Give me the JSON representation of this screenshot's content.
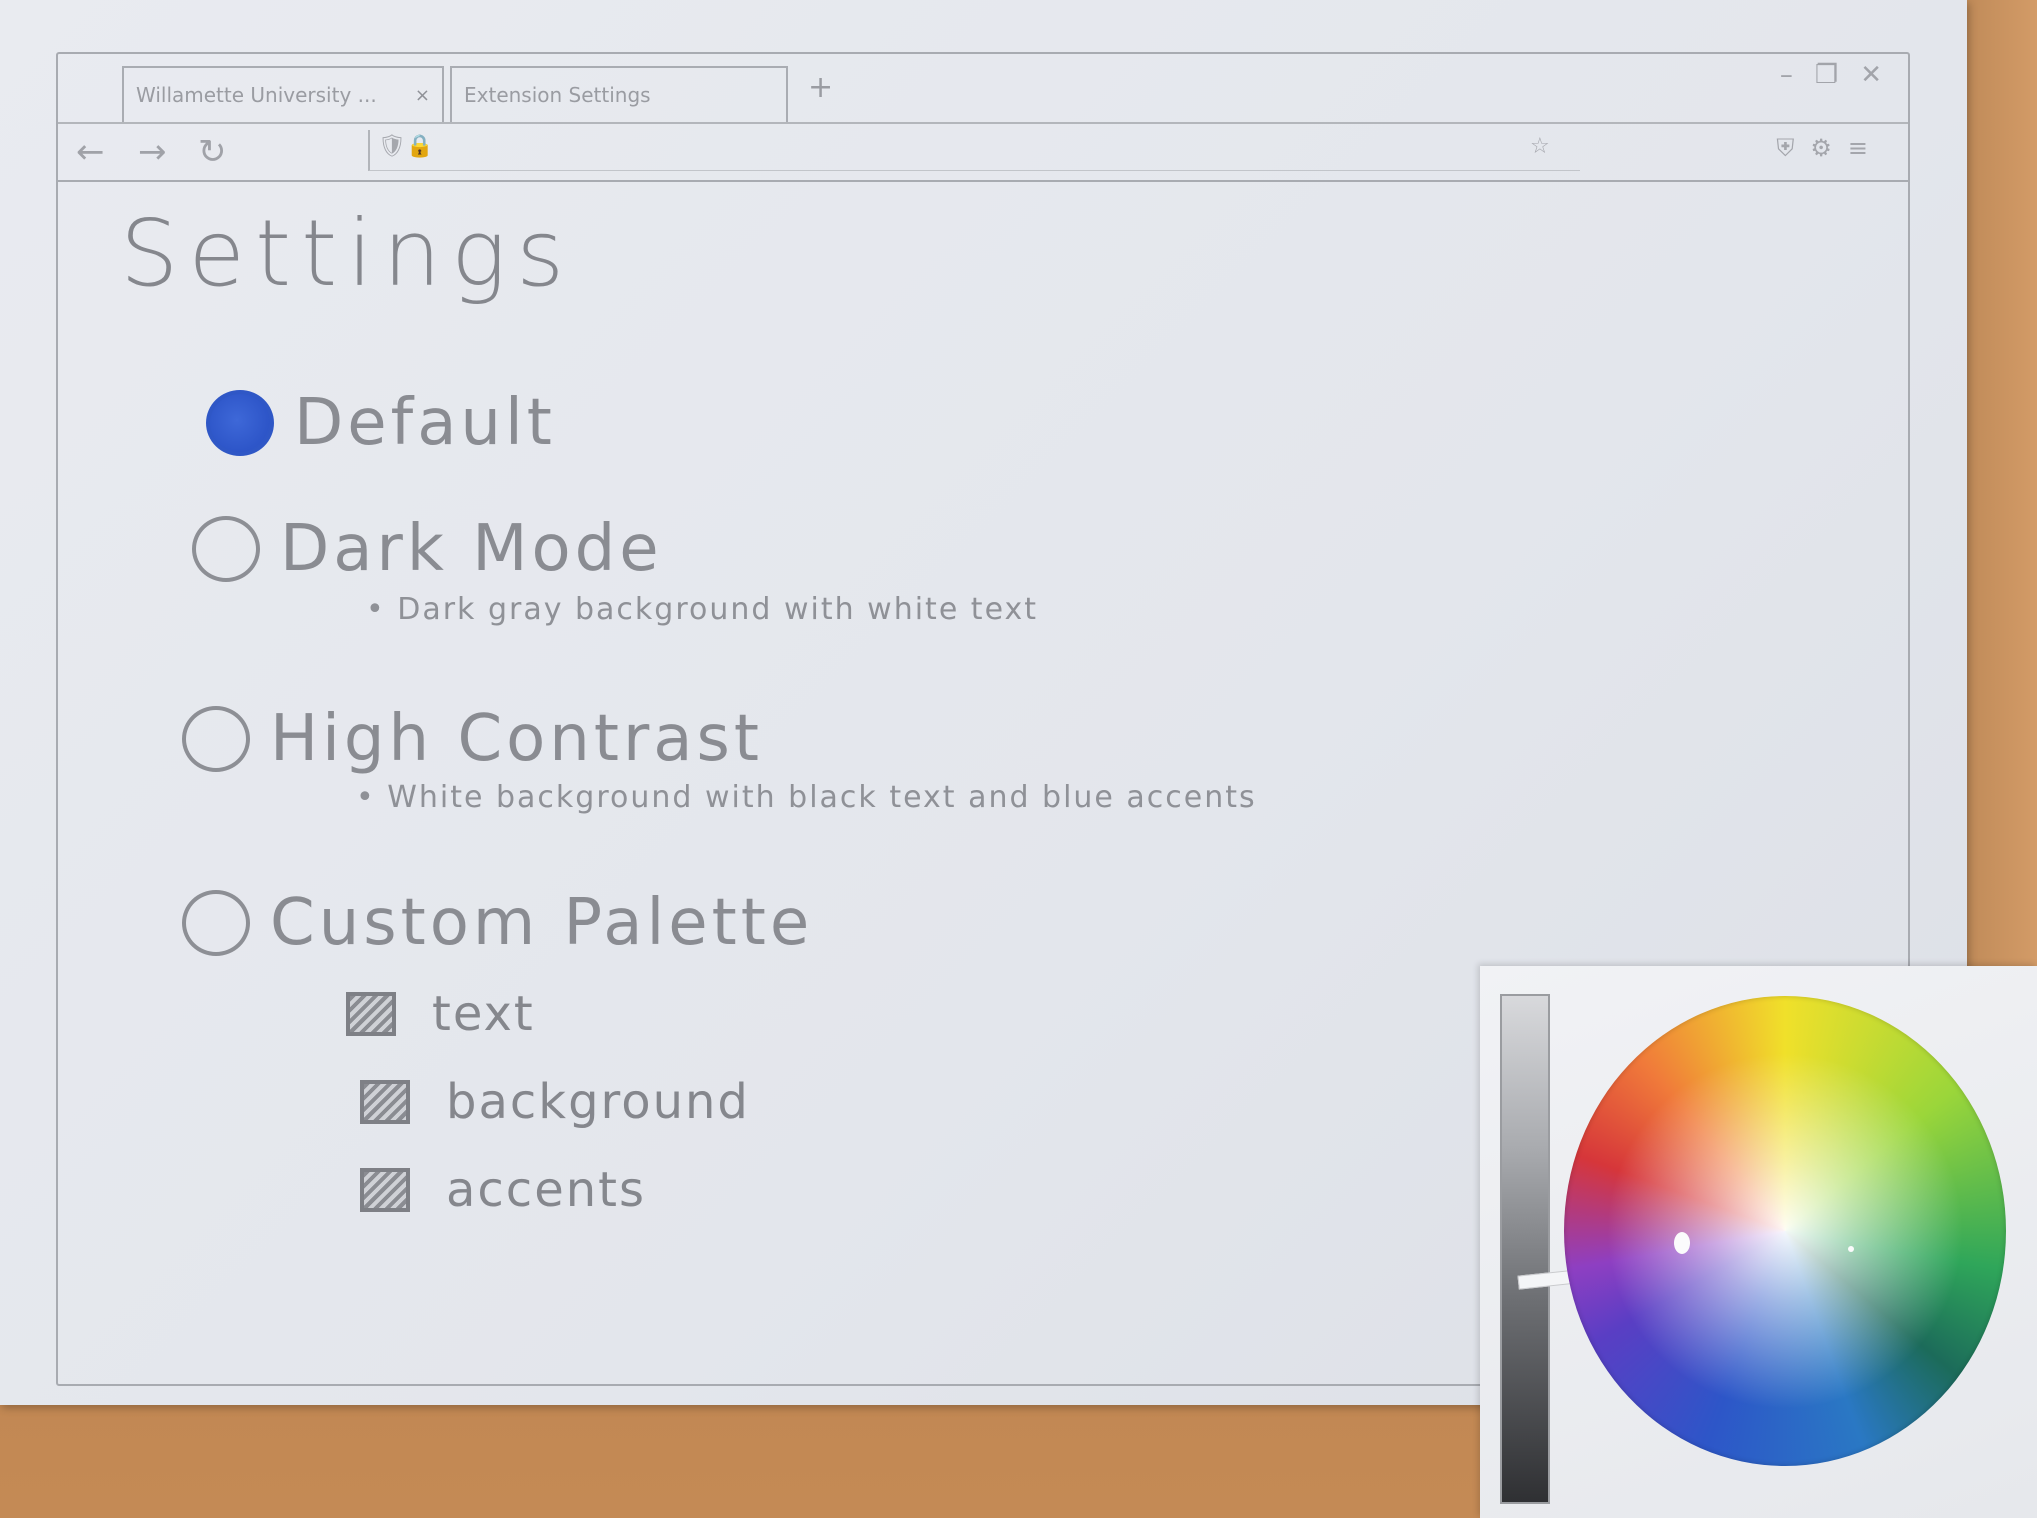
{
  "browser": {
    "tabs": [
      {
        "label": "Willamette University ...",
        "close": "×"
      },
      {
        "label": "Extension Settings"
      }
    ],
    "new_tab": "+",
    "window_controls": {
      "minimize": "–",
      "restore": "❐",
      "close": "✕"
    },
    "nav": {
      "back": "←",
      "forward": "→",
      "reload": "↻"
    },
    "address_icons": {
      "shield": "🛡",
      "lock": "🔒"
    },
    "star": "☆",
    "toolbar": {
      "shield": "⛨",
      "extensions": "⚙",
      "menu": "≡"
    }
  },
  "settings": {
    "title": "Settings",
    "options": [
      {
        "label": "Default",
        "selected": true
      },
      {
        "label": "Dark Mode",
        "selected": false,
        "description": "• Dark gray background with white text"
      },
      {
        "label": "High Contrast",
        "selected": false,
        "description": "• White background with black text and blue accents"
      },
      {
        "label": "Custom Palette",
        "selected": false
      }
    ],
    "custom_palette": [
      {
        "label": "text"
      },
      {
        "label": "background"
      },
      {
        "label": "accents"
      }
    ]
  },
  "colors": {
    "accent_selected": "#2f57c6",
    "pencil": "#8a8c92"
  }
}
